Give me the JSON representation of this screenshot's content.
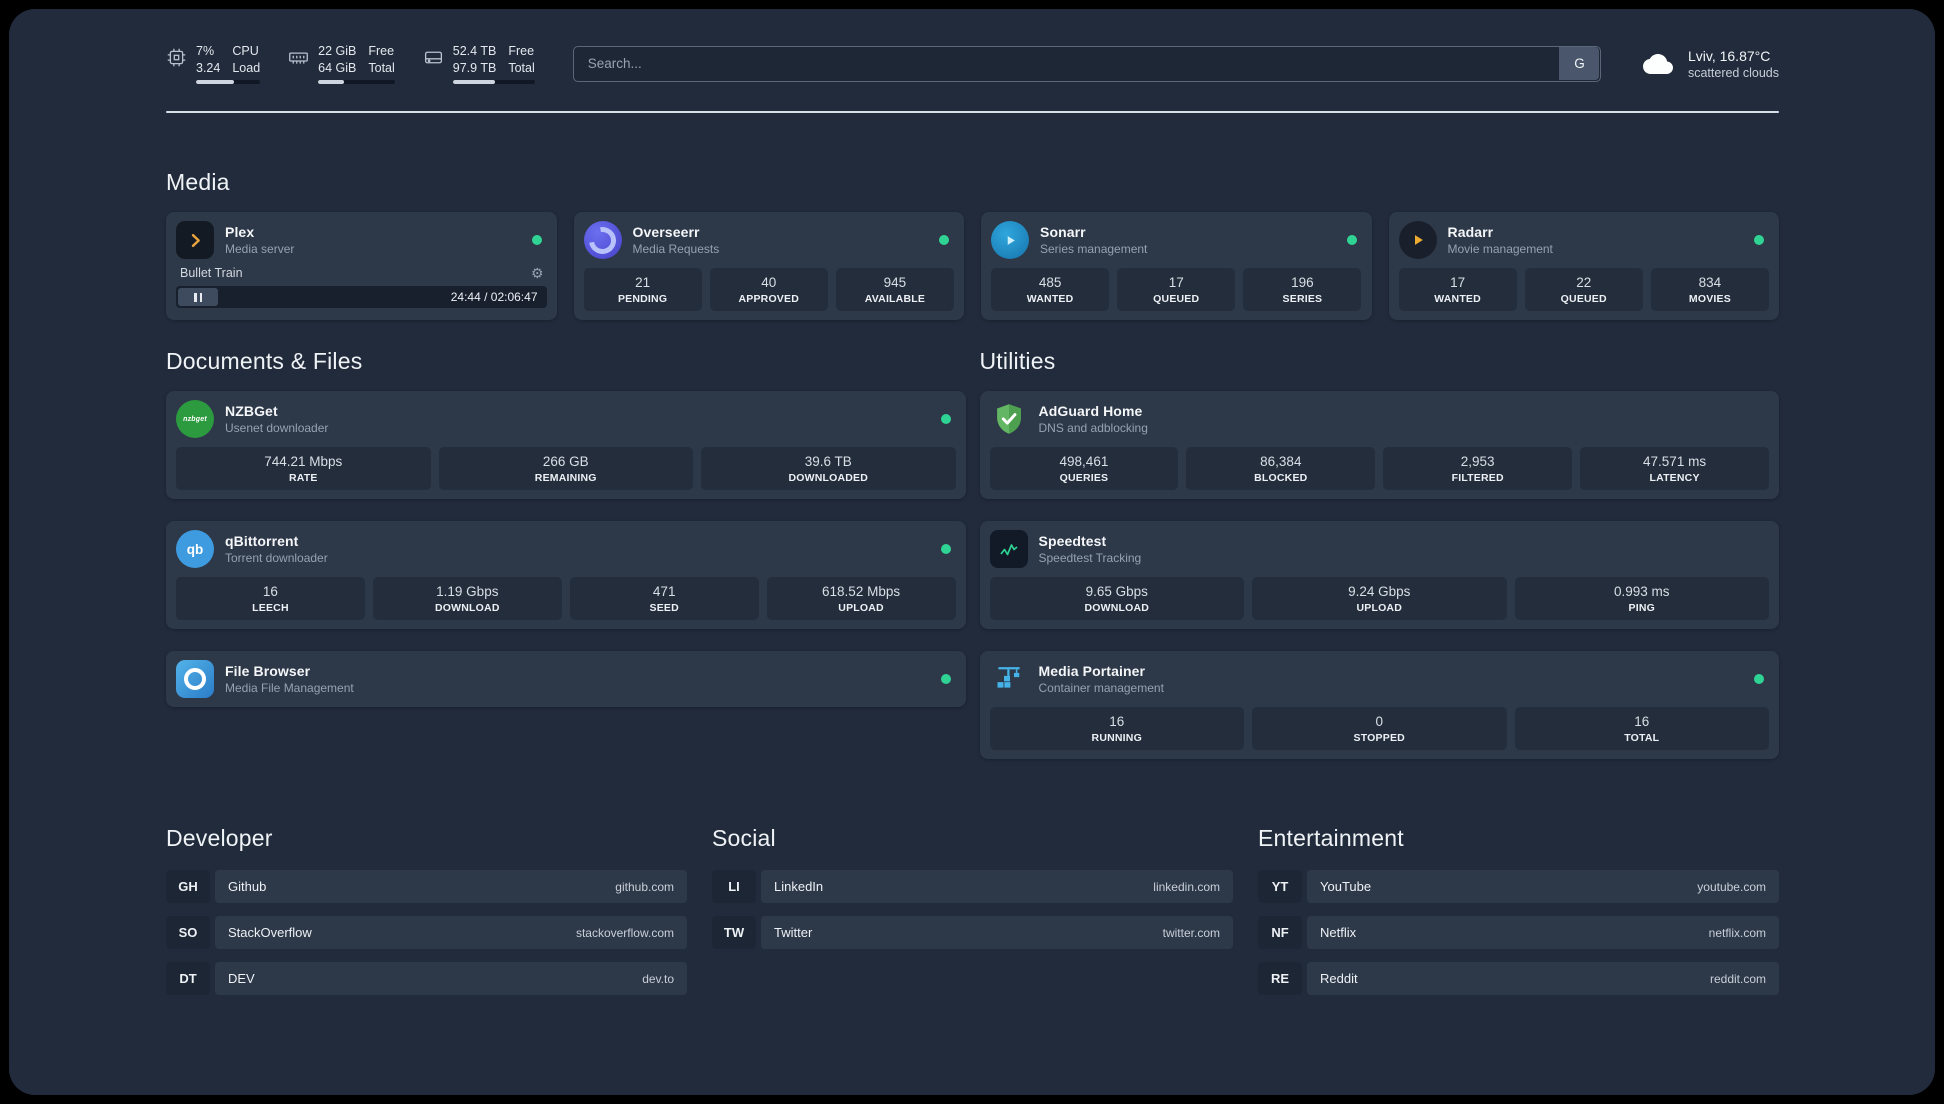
{
  "topbar": {
    "resources": [
      {
        "widget": "cpu",
        "val1": "7%",
        "val2": "3.24",
        "lab1": "CPU",
        "lab2": "Load",
        "bar_percent": 60
      },
      {
        "widget": "memory",
        "val1": "22 GiB",
        "val2": "64 GiB",
        "lab1": "Free",
        "lab2": "Total",
        "bar_percent": 34
      },
      {
        "widget": "disk",
        "val1": "52.4 TB",
        "val2": "97.9 TB",
        "lab1": "Free",
        "lab2": "Total",
        "bar_percent": 52
      }
    ],
    "search": {
      "placeholder": "Search...",
      "provider_label": "G"
    },
    "weather": {
      "location": "Lviv, 16.87°C",
      "condition": "scattered clouds"
    }
  },
  "media": {
    "title": "Media",
    "services": [
      {
        "name": "Plex",
        "description": "Media server",
        "status": "online",
        "player": {
          "track": "Bullet Train",
          "time": "24:44 / 02:06:47"
        }
      },
      {
        "name": "Overseerr",
        "description": "Media Requests",
        "status": "online",
        "stats": [
          {
            "value": "21",
            "label": "PENDING"
          },
          {
            "value": "40",
            "label": "APPROVED"
          },
          {
            "value": "945",
            "label": "AVAILABLE"
          }
        ]
      },
      {
        "name": "Sonarr",
        "description": "Series management",
        "status": "online",
        "stats": [
          {
            "value": "485",
            "label": "WANTED"
          },
          {
            "value": "17",
            "label": "QUEUED"
          },
          {
            "value": "196",
            "label": "SERIES"
          }
        ]
      },
      {
        "name": "Radarr",
        "description": "Movie management",
        "status": "online",
        "stats": [
          {
            "value": "17",
            "label": "WANTED"
          },
          {
            "value": "22",
            "label": "QUEUED"
          },
          {
            "value": "834",
            "label": "MOVIES"
          }
        ]
      }
    ]
  },
  "documents": {
    "title": "Documents & Files",
    "services": [
      {
        "name": "NZBGet",
        "description": "Usenet downloader",
        "status": "online",
        "stats": [
          {
            "value": "744.21 Mbps",
            "label": "RATE"
          },
          {
            "value": "266 GB",
            "label": "REMAINING"
          },
          {
            "value": "39.6 TB",
            "label": "DOWNLOADED"
          }
        ]
      },
      {
        "name": "qBittorrent",
        "description": "Torrent downloader",
        "status": "online",
        "stats": [
          {
            "value": "16",
            "label": "LEECH"
          },
          {
            "value": "1.19 Gbps",
            "label": "DOWNLOAD"
          },
          {
            "value": "471",
            "label": "SEED"
          },
          {
            "value": "618.52 Mbps",
            "label": "UPLOAD"
          }
        ]
      },
      {
        "name": "File Browser",
        "description": "Media File Management",
        "status": "online"
      }
    ]
  },
  "utilities": {
    "title": "Utilities",
    "services": [
      {
        "name": "AdGuard Home",
        "description": "DNS and adblocking",
        "stats": [
          {
            "value": "498,461",
            "label": "QUERIES"
          },
          {
            "value": "86,384",
            "label": "BLOCKED"
          },
          {
            "value": "2,953",
            "label": "FILTERED"
          },
          {
            "value": "47.571 ms",
            "label": "LATENCY"
          }
        ]
      },
      {
        "name": "Speedtest",
        "description": "Speedtest Tracking",
        "stats": [
          {
            "value": "9.65 Gbps",
            "label": "DOWNLOAD"
          },
          {
            "value": "9.24 Gbps",
            "label": "UPLOAD"
          },
          {
            "value": "0.993 ms",
            "label": "PING"
          }
        ]
      },
      {
        "name": "Media Portainer",
        "description": "Container management",
        "status": "online",
        "stats": [
          {
            "value": "16",
            "label": "RUNNING"
          },
          {
            "value": "0",
            "label": "STOPPED"
          },
          {
            "value": "16",
            "label": "TOTAL"
          }
        ]
      }
    ]
  },
  "bookmarks": {
    "groups": [
      {
        "title": "Developer",
        "items": [
          {
            "abbr": "GH",
            "name": "Github",
            "url": "github.com"
          },
          {
            "abbr": "SO",
            "name": "StackOverflow",
            "url": "stackoverflow.com"
          },
          {
            "abbr": "DT",
            "name": "DEV",
            "url": "dev.to"
          }
        ]
      },
      {
        "title": "Social",
        "items": [
          {
            "abbr": "LI",
            "name": "LinkedIn",
            "url": "linkedin.com"
          },
          {
            "abbr": "TW",
            "name": "Twitter",
            "url": "twitter.com"
          }
        ]
      },
      {
        "title": "Entertainment",
        "items": [
          {
            "abbr": "YT",
            "name": "YouTube",
            "url": "youtube.com"
          },
          {
            "abbr": "NF",
            "name": "Netflix",
            "url": "netflix.com"
          },
          {
            "abbr": "RE",
            "name": "Reddit",
            "url": "reddit.com"
          }
        ]
      }
    ]
  },
  "icon_labels": {
    "nzbget": "nzbget",
    "qbittorrent": "qb"
  },
  "colors": {
    "background": "#212b3b",
    "card": "#2d3848",
    "stat_tile": "#232d3c",
    "status_online": "#2fd495",
    "plex_accent": "#e8a33d",
    "radarr_accent": "#efac33",
    "speedtest_accent": "#2fd495",
    "divider": "#d8dee7"
  }
}
